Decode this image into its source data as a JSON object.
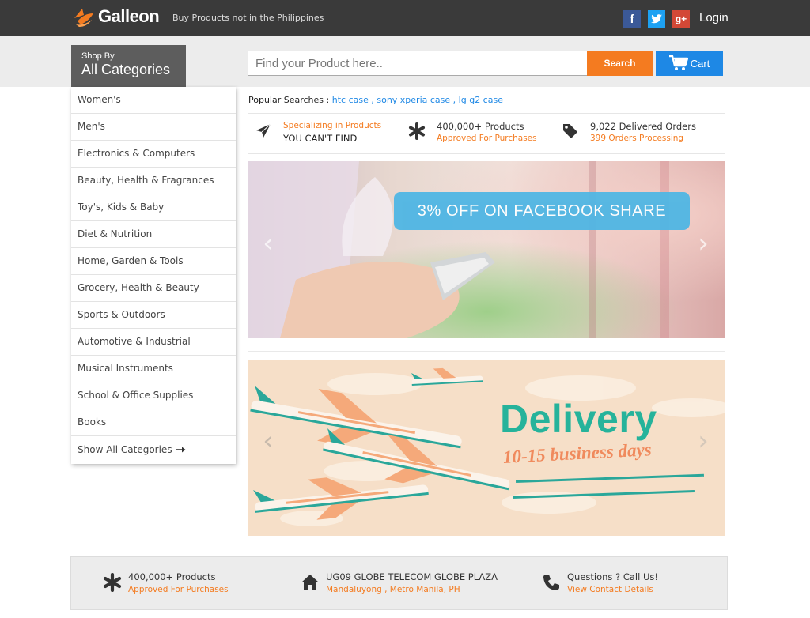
{
  "header": {
    "logo_text": "Galleon",
    "tagline": "Buy Products not in the Philippines",
    "login_label": "Login",
    "social": [
      {
        "name": "facebook",
        "glyph": "f",
        "color": "#3b5998"
      },
      {
        "name": "twitter",
        "glyph": "t",
        "color": "#1da1f2"
      },
      {
        "name": "google-plus",
        "glyph": "g+",
        "color": "#d34836"
      }
    ]
  },
  "shop_by": {
    "small": "Shop By",
    "big": "All Categories"
  },
  "search": {
    "placeholder": "Find your Product here..",
    "button_label": "Search",
    "cart_label": "Cart"
  },
  "sidebar": {
    "items": [
      {
        "label": "Women's"
      },
      {
        "label": "Men's"
      },
      {
        "label": "Electronics & Computers"
      },
      {
        "label": "Beauty, Health & Fragrances"
      },
      {
        "label": "Toy's, Kids & Baby"
      },
      {
        "label": "Diet & Nutrition"
      },
      {
        "label": "Home, Garden & Tools"
      },
      {
        "label": "Grocery, Health & Beauty"
      },
      {
        "label": "Sports & Outdoors"
      },
      {
        "label": "Automotive & Industrial"
      },
      {
        "label": "Musical Instruments"
      },
      {
        "label": "School & Office Supplies"
      },
      {
        "label": "Books"
      }
    ],
    "show_all_label": "Show All Categories"
  },
  "popular": {
    "label": "Popular Searches :",
    "links": [
      "htc case",
      "sony xperia case",
      "lg g2 case"
    ]
  },
  "features": [
    {
      "icon": "plane-icon",
      "line1": "Specializing in Products",
      "line2": "YOU CAN'T FIND"
    },
    {
      "icon": "asterisk-icon",
      "line1": "400,000+ Products",
      "line2": "Approved For Purchases"
    },
    {
      "icon": "tag-icon",
      "line1": "9,022 Delivered Orders",
      "line2": "399 Orders Processing"
    }
  ],
  "banner1": {
    "promo_text": "3% OFF ON FACEBOOK SHARE"
  },
  "banner2": {
    "title": "Delivery",
    "subtitle": "10-15 business days"
  },
  "footer": [
    {
      "icon": "asterisk-icon",
      "line1": "400,000+ Products",
      "line2": "Approved For Purchases"
    },
    {
      "icon": "home-icon",
      "line1": "UG09 GLOBE TELECOM GLOBE PLAZA",
      "line2": "Mandaluyong , Metro Manila, PH"
    },
    {
      "icon": "phone-icon",
      "line1": "Questions ? Call Us!",
      "line2": "View Contact Details"
    }
  ],
  "colors": {
    "topbar": "#3a3a3a",
    "accent_orange": "#f47b20",
    "accent_blue": "#1e88e5",
    "delivery_teal": "#26b39b"
  }
}
